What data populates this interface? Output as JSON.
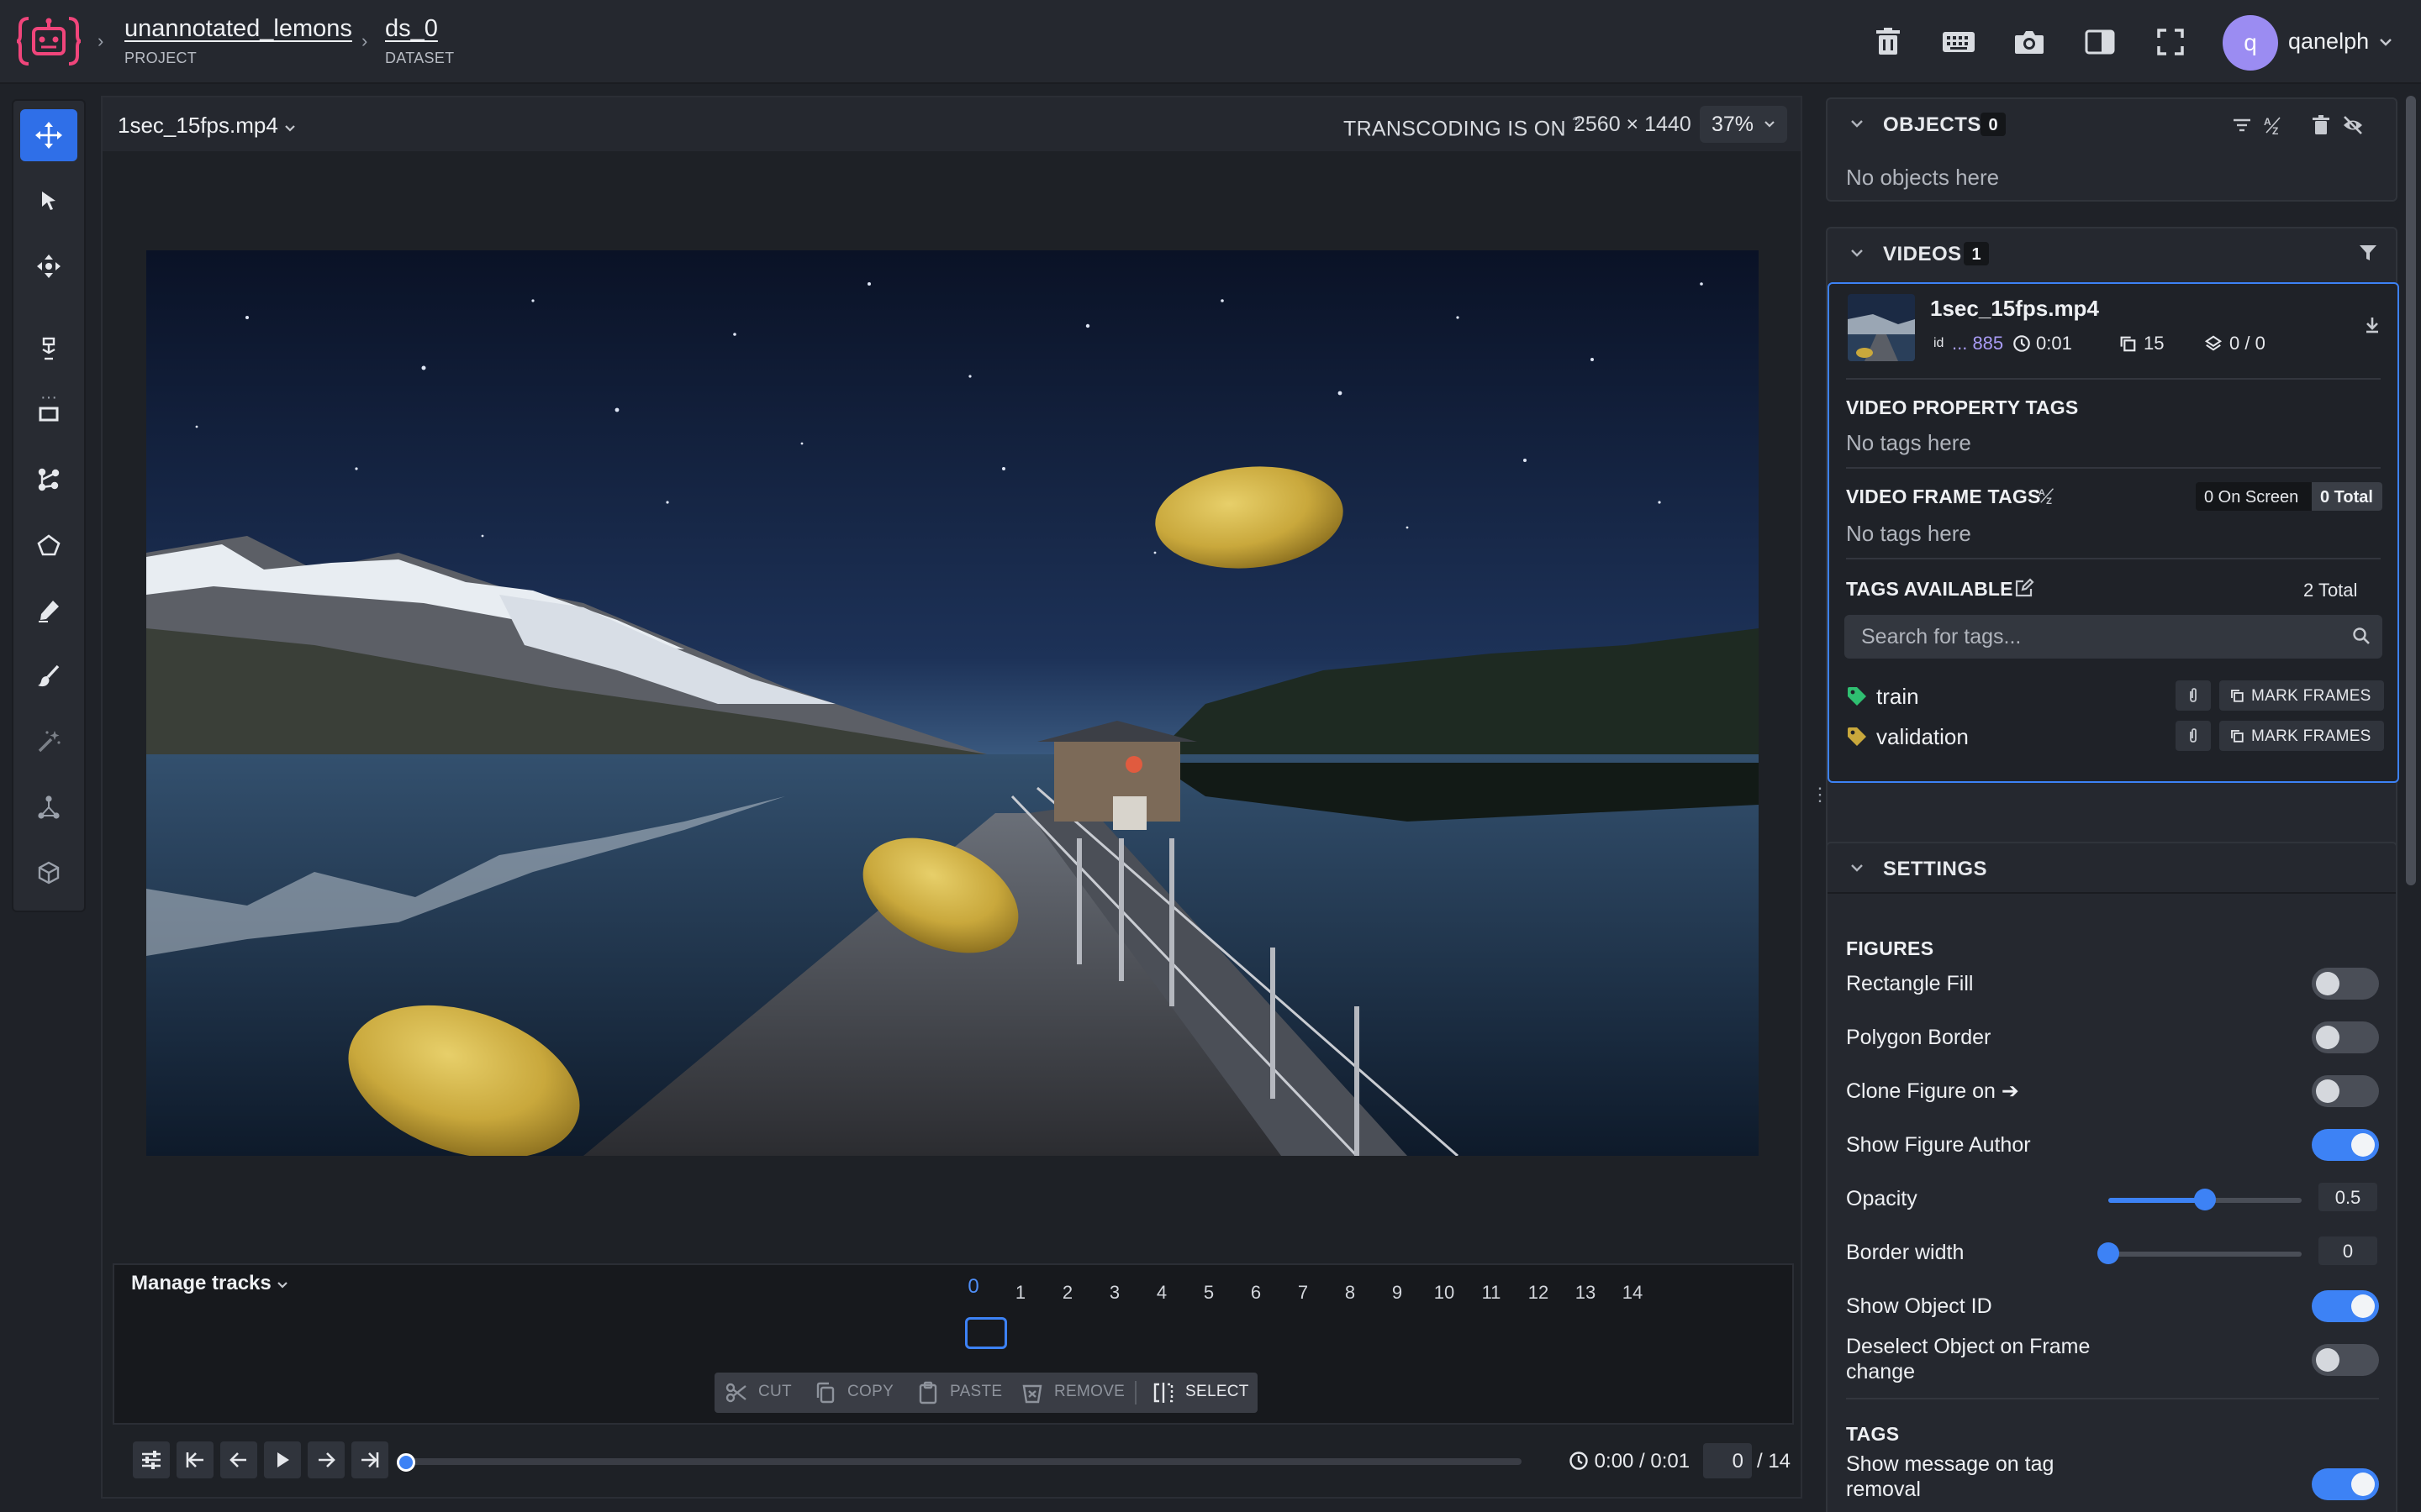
{
  "header": {
    "project_name": "unannotated_lemons",
    "project_label": "PROJECT",
    "dataset_name": "ds_0",
    "dataset_label": "DATASET",
    "user_initial": "q",
    "username": "qanelph",
    "icons": [
      "trash-icon",
      "keyboard-icon",
      "camera-icon",
      "sidebar-icon",
      "fullscreen-icon"
    ]
  },
  "toolbar": {
    "tools": [
      "move-tool",
      "select-tool",
      "drag-tool",
      "smart-tool",
      "rectangle-tool",
      "graph-tool",
      "polygon-tool",
      "brush-tool",
      "eraser-tool",
      "magic-wand-tool",
      "skeleton-tool",
      "cuboid-tool"
    ],
    "active": "move-tool"
  },
  "viewer": {
    "file_name": "1sec_15fps.mp4",
    "transcoding": "TRANSCODING IS ON",
    "help_mark": "?",
    "resolution": "2560 × 1440",
    "zoom": "37%"
  },
  "timeline": {
    "manage_tracks": "Manage tracks",
    "frames": [
      "0",
      "1",
      "2",
      "3",
      "4",
      "5",
      "6",
      "7",
      "8",
      "9",
      "10",
      "11",
      "12",
      "13",
      "14"
    ],
    "current_frame": "0",
    "edit_actions": {
      "cut": "CUT",
      "copy": "COPY",
      "paste": "PASTE",
      "remove": "REMOVE",
      "select": "SELECT"
    },
    "time": "0:00 / 0:01",
    "frame_input": "0",
    "frame_total": "/ 14",
    "progress": 0
  },
  "objects": {
    "title": "OBJECTS",
    "count": "0",
    "empty": "No objects here"
  },
  "videos": {
    "title": "VIDEOS",
    "count": "1",
    "item": {
      "name": "1sec_15fps.mp4",
      "id_label": "id",
      "id_value": "... 885",
      "duration": "0:01",
      "frames": "15",
      "objects": "0 / 0"
    },
    "property_tags_title": "VIDEO PROPERTY TAGS",
    "property_tags_empty": "No tags here",
    "frame_tags_title": "VIDEO FRAME TAGS",
    "on_screen": "0 On Screen",
    "total": "0 Total",
    "frame_tags_empty": "No tags here",
    "available_title": "TAGS AVAILABLE",
    "available_total": "2 Total",
    "search_placeholder": "Search for tags...",
    "tags": [
      {
        "name": "train",
        "color": "#2fbf71",
        "action": "MARK FRAMES"
      },
      {
        "name": "validation",
        "color": "#c9a83c",
        "action": "MARK FRAMES"
      }
    ]
  },
  "settings": {
    "title": "SETTINGS",
    "figures_title": "FIGURES",
    "rectangle_fill": "Rectangle Fill",
    "polygon_border": "Polygon Border",
    "clone_figure": "Clone Figure on ➔",
    "show_author": "Show Figure Author",
    "opacity": "Opacity",
    "opacity_value": "0.5",
    "border_width": "Border width",
    "border_width_value": "0",
    "show_object_id": "Show Object ID",
    "deselect_line1": "Deselect Object on Frame",
    "deselect_line2": "change",
    "tags_title": "TAGS",
    "tag_removal_line1": "Show message on tag",
    "tag_removal_line2": "removal"
  },
  "colors": {
    "accent": "#3d82f5",
    "logo": "#f0457b"
  }
}
